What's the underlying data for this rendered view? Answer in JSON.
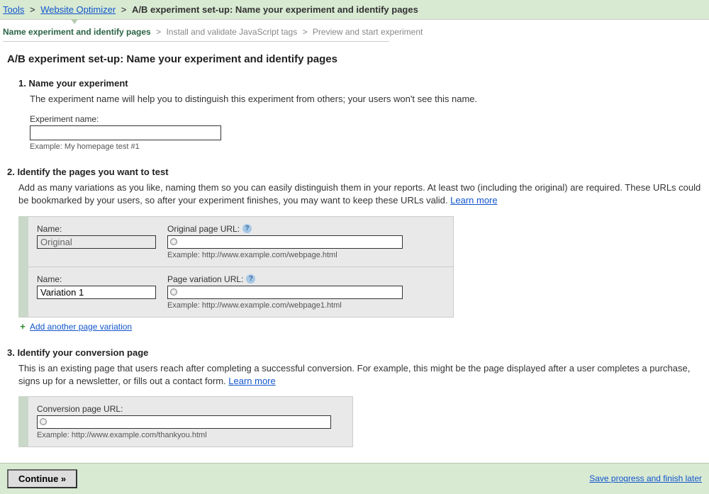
{
  "breadcrumb": {
    "tools": "Tools",
    "optimizer": "Website Optimizer",
    "current": "A/B experiment set-up: Name your experiment and identify pages"
  },
  "steps": {
    "s1": "Name experiment and identify pages",
    "s2": "Install and validate JavaScript tags",
    "s3": "Preview and start experiment"
  },
  "page_title": "A/B experiment set-up: Name your experiment and identify pages",
  "section1": {
    "header": "1. Name your experiment",
    "desc": "The experiment name will help you to distinguish this experiment from others; your users won't see this name.",
    "label": "Experiment name:",
    "value": "",
    "example": "Example: My homepage test #1"
  },
  "section2": {
    "header": "2. Identify the pages you want to test",
    "desc": "Add as many variations as you like, naming them so you can easily distinguish them in your reports. At least two (including the original) are required. These URLs could be bookmarked by your users, so after your experiment finishes, you may want to keep these URLs valid.  ",
    "learn_more": "Learn more",
    "rows": [
      {
        "name_label": "Name:",
        "name_value": "Original",
        "readonly": true,
        "url_label": "Original page URL:",
        "url_value": "",
        "url_example": "Example: http://www.example.com/webpage.html"
      },
      {
        "name_label": "Name:",
        "name_value": "Variation 1",
        "readonly": false,
        "url_label": "Page variation URL:",
        "url_value": "",
        "url_example": "Example: http://www.example.com/webpage1.html"
      }
    ],
    "add_link": "Add another page variation"
  },
  "section3": {
    "header": "3. Identify your conversion page",
    "desc": "This is an existing page that users reach after completing a successful conversion. For example, this might be the page displayed after a user completes a purchase, signs up for a newsletter, or fills out a contact form.  ",
    "learn_more": "Learn more",
    "label": "Conversion page URL:",
    "value": "",
    "example": "Example: http://www.example.com/thankyou.html"
  },
  "footer": {
    "continue": "Continue »",
    "save": "Save progress and finish later"
  }
}
